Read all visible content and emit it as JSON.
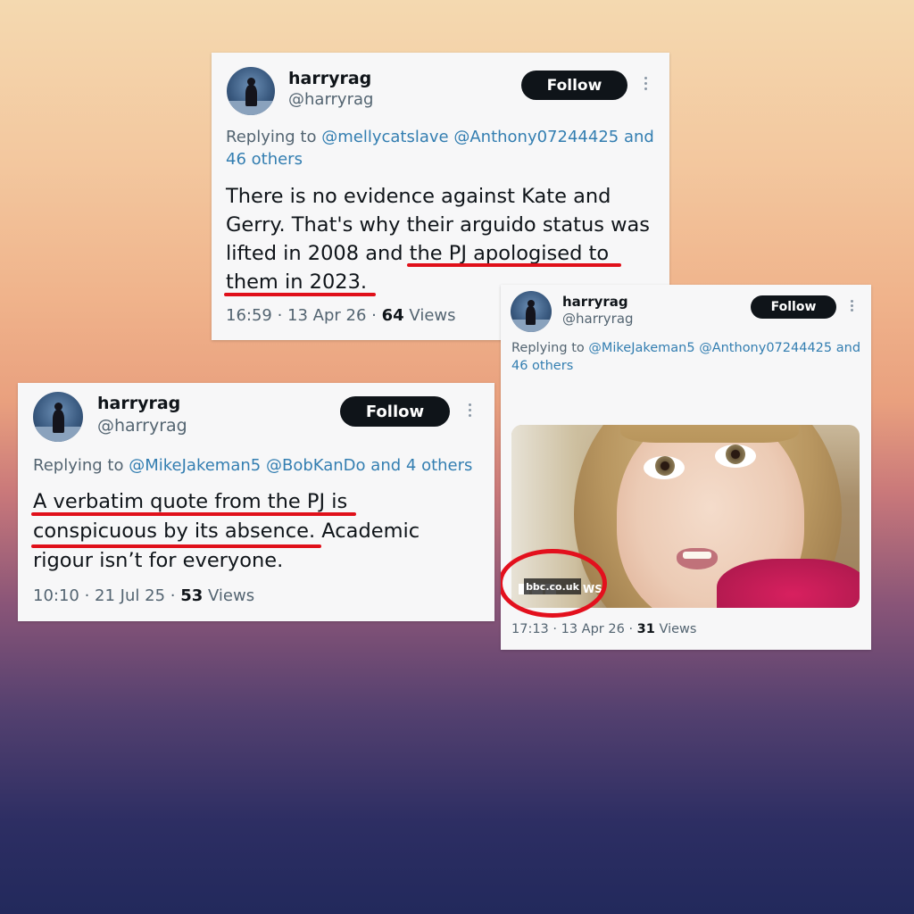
{
  "tweet1": {
    "name": "harryrag",
    "handle": "@harryrag",
    "follow_label": "Follow",
    "reply_prefix": "Replying to",
    "reply_mention_1": "@mellycatslave",
    "reply_mention_2": "@Anthony07244425",
    "reply_and": "and",
    "reply_others": "46 others",
    "body_line_1": "There is no evidence against Kate and",
    "body_line_2": "Gerry. That's why their arguido status was",
    "body_line_3": "lifted in 2008 and the PJ apologised to",
    "body_line_4": "them in 2023.",
    "time": "16:59",
    "date": "13 Apr 26",
    "views_count": "64",
    "views_label": "Views"
  },
  "tweet2": {
    "name": "harryrag",
    "handle": "@harryrag",
    "follow_label": "Follow",
    "reply_prefix": "Replying to",
    "reply_mention_1": "@MikeJakeman5",
    "reply_mention_2": "@BobKanDo",
    "reply_and": "and",
    "reply_others": "4 others",
    "body_line_1": "A verbatim quote from the PJ is",
    "body_line_2": "conspicuous by its absence. Academic",
    "body_line_3": "rigour isn’t for everyone.",
    "time": "10:10",
    "date": "21 Jul 25",
    "views_count": "53",
    "views_label": "Views"
  },
  "tweet3": {
    "name": "harryrag",
    "handle": "@harryrag",
    "follow_label": "Follow",
    "reply_prefix": "Replying to",
    "reply_mention_1": "@MikeJakeman5",
    "reply_mention_2": "@Anthony07244425",
    "reply_and": "and",
    "reply_others": "46 others",
    "photo_watermark": "bbc.co.uk",
    "photo_news": "WS",
    "time": "17:13",
    "date": "13 Apr 26",
    "views_count": "31",
    "views_label": "Views"
  },
  "colors": {
    "underline": "#e0101a",
    "link": "#1d9bf0",
    "follow_bg": "#0f1419"
  },
  "icons": [
    "more-dots-icon"
  ]
}
